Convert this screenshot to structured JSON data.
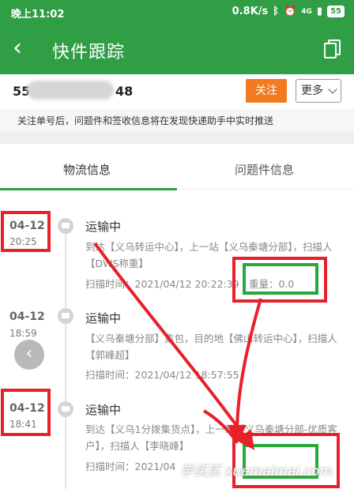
{
  "status_bar": {
    "time": "晚上11:02",
    "network_speed": "0.8K/s",
    "signal": "4G",
    "battery": "55"
  },
  "header": {
    "title": "快件跟踪"
  },
  "tracking": {
    "number_prefix": "55",
    "number_suffix": "48",
    "follow_label": "关注",
    "more_label": "更多",
    "notice_text": "关注单号后，问题件和签收信息将在发现快递助手中实时推送"
  },
  "tabs": [
    {
      "label": "物流信息",
      "active": true
    },
    {
      "label": "问题件信息",
      "active": false
    }
  ],
  "timeline": [
    {
      "date": "04-12",
      "time": "20:25",
      "status": "运输中",
      "description": "到达【义乌转运中心】，上一站【义乌秦塘分部】，扫描人【DWS称重】",
      "scan_time": "扫描时间：2021/04/12 20:22:39",
      "weight": "重量：0.0"
    },
    {
      "date": "04-12",
      "time": "18:59",
      "status": "运输中",
      "description": "【义乌秦塘分部】集包，目的地【佛山转运中心】，扫描人【郭峰超】",
      "scan_time": "扫描时间：2021/04/12 18:57:55"
    },
    {
      "date": "04-12",
      "time": "18:41",
      "status": "运输中",
      "description": "到达【义乌1分拨集货点】，上一站【义乌秦塘分部-优质客户】，扫描人【李晓峰】",
      "scan_time": "扫描时间：2021/04"
    }
  ],
  "watermark": "学买买 xuemaimai.com",
  "colors": {
    "primary_green": "#2f9e45",
    "follow_orange": "#f07b20",
    "annotation_red": "#e8202a",
    "annotation_green": "#27a83a"
  }
}
